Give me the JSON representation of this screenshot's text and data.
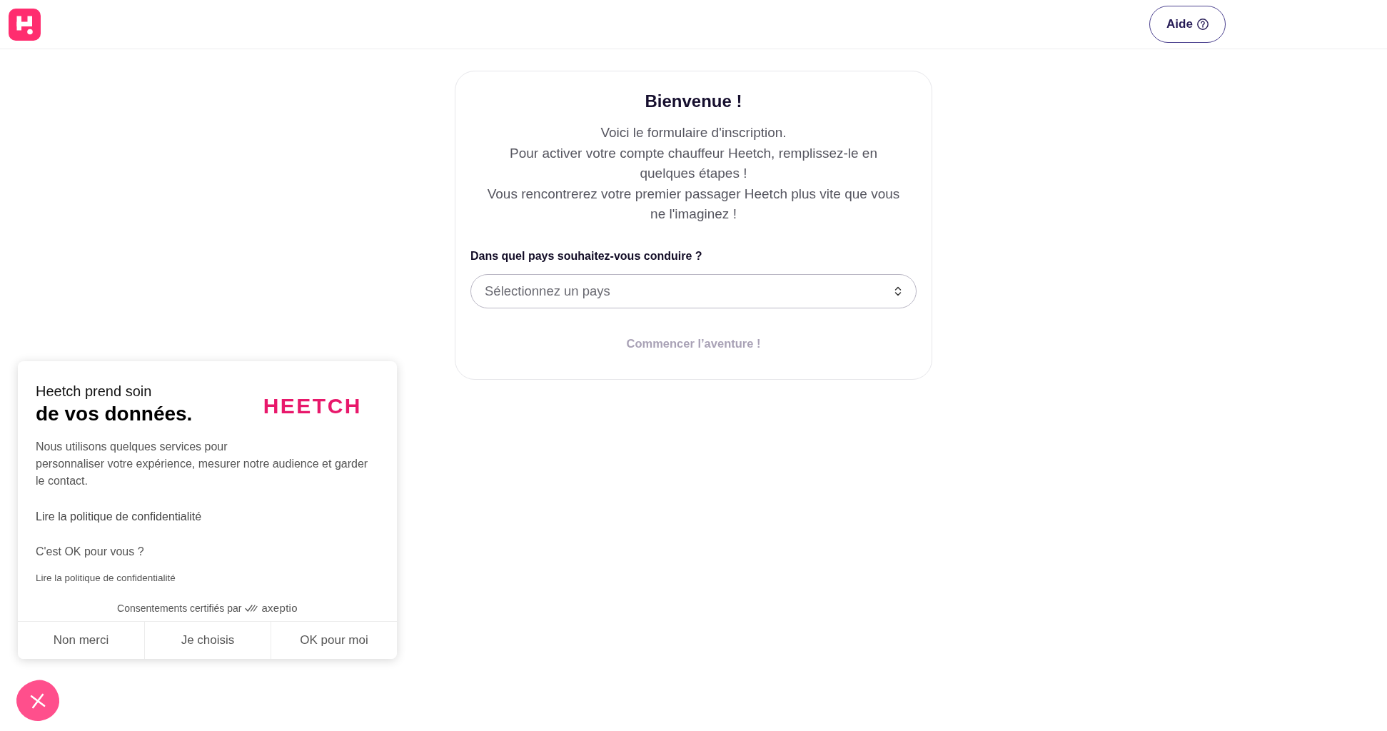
{
  "header": {
    "help_button": {
      "label": "Aide"
    }
  },
  "card": {
    "title": "Bienvenue !",
    "intro_lines": [
      "Voici le formulaire d'inscription.",
      "Pour activer votre compte chauffeur Heetch, remplissez-le en quelques étapes !",
      "Vous rencontrerez votre premier passager Heetch plus vite que vous ne l'imaginez !"
    ],
    "country_field": {
      "label": "Dans quel pays souhaitez-vous conduire ?",
      "placeholder": "Sélectionnez un pays"
    },
    "start_button": {
      "label": "Commencer l’aventure !",
      "disabled": true
    }
  },
  "cookie_banner": {
    "heading_line_1": "Heetch prend soin",
    "heading_line_2": "de vos données.",
    "brand": "HEETCH",
    "description_lines": [
      "Nous utilisons quelques services pour",
      "personnaliser votre expérience, mesurer notre audience et garder le contact."
    ],
    "privacy_link": "Lire la politique de confidentialité",
    "question": "C'est OK pour vous ?",
    "privacy_link_small": "Lire la politique de confidentialité",
    "certified_text": "Consentements certifiés par",
    "certifier": "axeptio",
    "buttons": [
      "Non merci",
      "Je choisis",
      "OK pour moi"
    ]
  }
}
